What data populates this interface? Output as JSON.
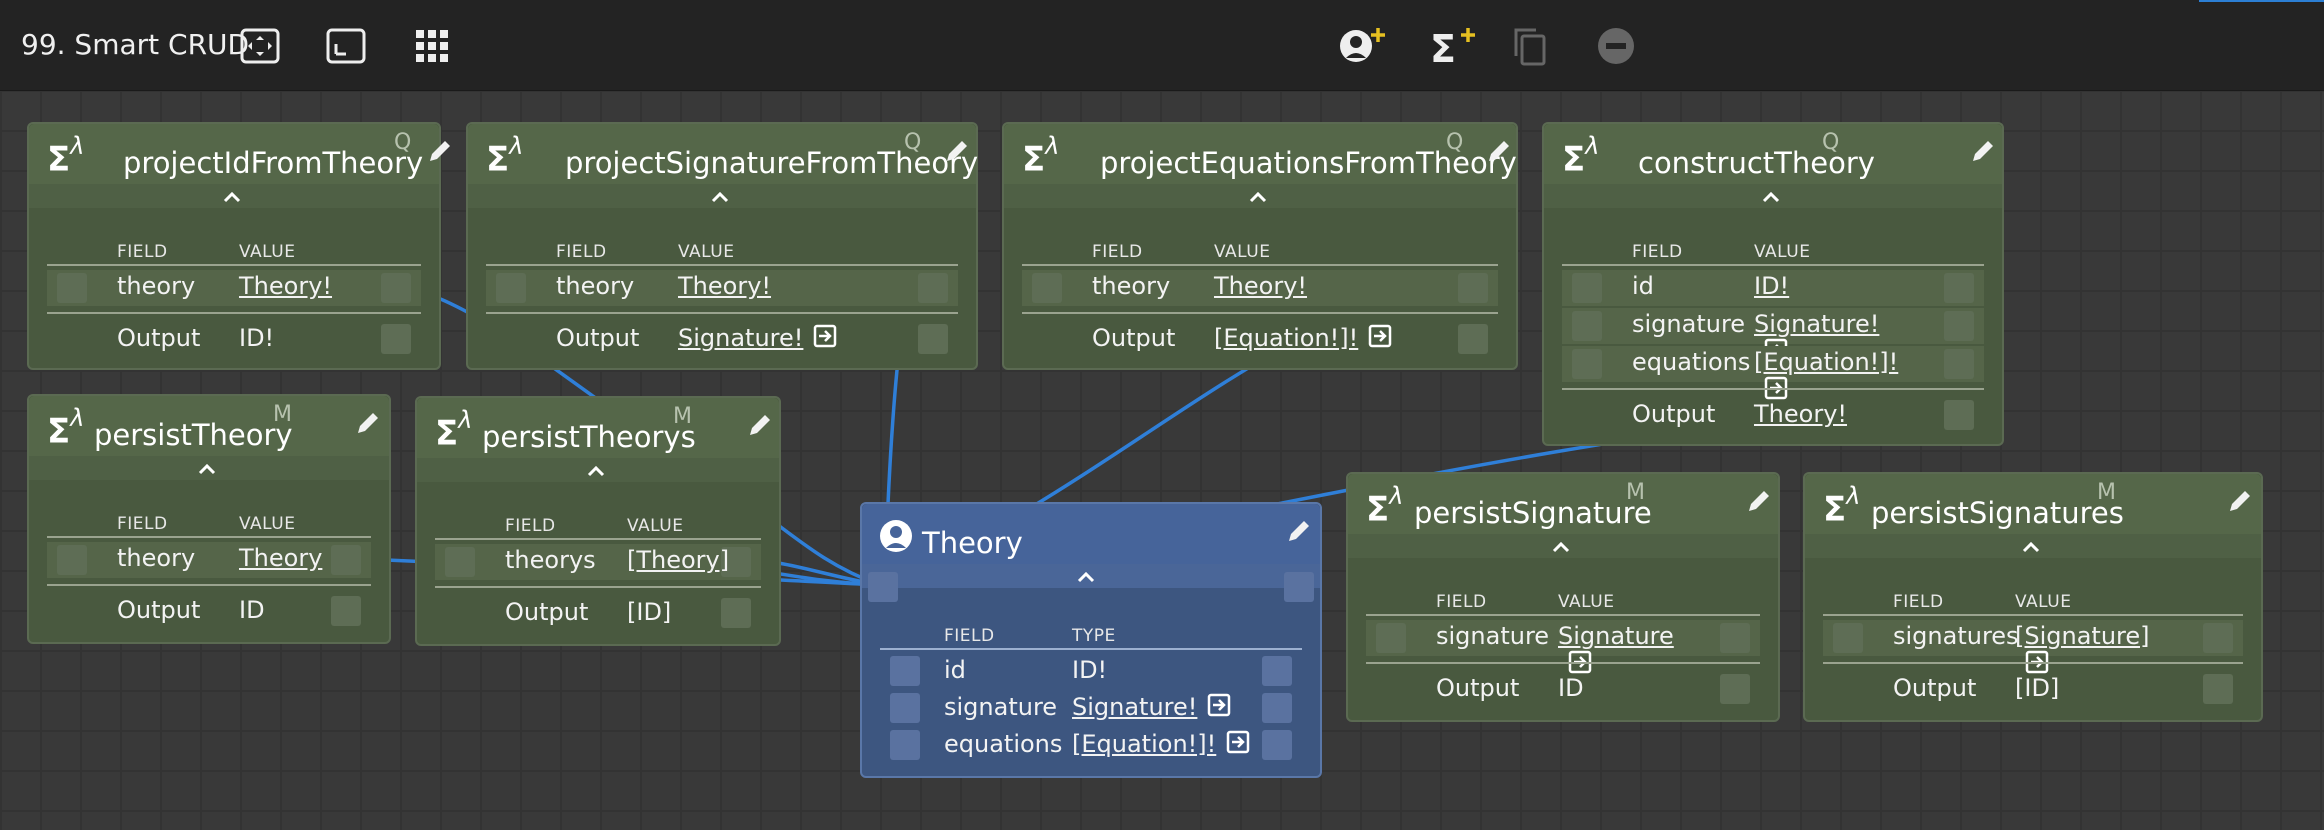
{
  "app": {
    "title": "99. Smart CRUD"
  },
  "toolbar": {
    "left_icons": [
      "fit-view-icon",
      "expand-view-icon",
      "grid-apps-icon"
    ],
    "center_icons": [
      "add-entity-icon",
      "add-function-icon",
      "copy-icon",
      "remove-icon"
    ]
  },
  "colors": {
    "function_node": "#49593f",
    "entity_node": "#3d5680",
    "wire": "#2f7fd8"
  },
  "labels": {
    "field": "FIELD",
    "value": "VALUE",
    "type": "TYPE",
    "output": "Output",
    "caret": "^"
  },
  "nodes": [
    {
      "name": "projectIdFromTheory",
      "tag": "Q",
      "fields": [
        {
          "field": "theory",
          "value": "Theory!"
        }
      ],
      "output": "ID!"
    },
    {
      "name": "projectSignatureFromTheory",
      "tag": "Q",
      "fields": [
        {
          "field": "theory",
          "value": "Theory!"
        }
      ],
      "output": "Signature!"
    },
    {
      "name": "projectEquationsFromTheory",
      "tag": "Q",
      "fields": [
        {
          "field": "theory",
          "value": "Theory!"
        }
      ],
      "output": "[Equation!]!"
    },
    {
      "name": "constructTheory",
      "tag": "Q",
      "fields": [
        {
          "field": "id",
          "value": "ID!"
        },
        {
          "field": "signature",
          "value": "Signature!"
        },
        {
          "field": "equations",
          "value": "[Equation!]!"
        }
      ],
      "output": "Theory!"
    },
    {
      "name": "persistTheory",
      "tag": "M",
      "fields": [
        {
          "field": "theory",
          "value": "Theory"
        }
      ],
      "output": "ID"
    },
    {
      "name": "persistTheorys",
      "tag": "M",
      "fields": [
        {
          "field": "theorys",
          "value": "[Theory]"
        }
      ],
      "output": "[ID]"
    },
    {
      "name": "persistSignature",
      "tag": "M",
      "fields": [
        {
          "field": "signature",
          "value": "Signature"
        }
      ],
      "output": "ID"
    },
    {
      "name": "persistSignatures",
      "tag": "M",
      "fields": [
        {
          "field": "signatures",
          "value": "[Signature]"
        }
      ],
      "output": "[ID]"
    }
  ],
  "entity": {
    "name": "Theory",
    "fields": [
      {
        "field": "id",
        "type": "ID!"
      },
      {
        "field": "signature",
        "type": "Signature!"
      },
      {
        "field": "equations",
        "type": "[Equation!]!"
      }
    ]
  }
}
